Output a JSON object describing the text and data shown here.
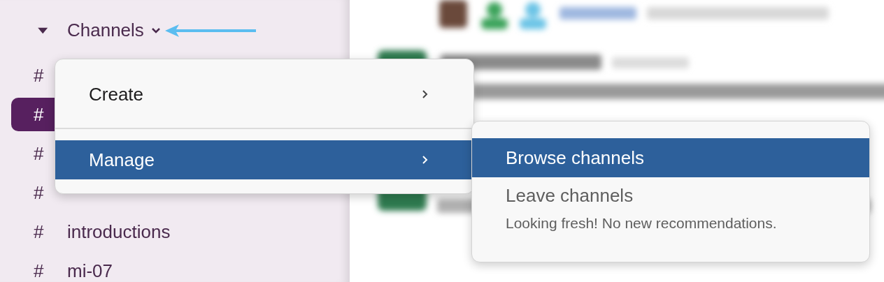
{
  "sidebar": {
    "section": {
      "title": "Channels",
      "expanded": true
    },
    "channels": [
      {
        "icon": "#",
        "selected": false
      },
      {
        "icon": "#",
        "selected": true
      },
      {
        "icon": "#",
        "selected": false
      },
      {
        "icon": "#",
        "selected": false
      },
      {
        "icon": "#",
        "name": "introductions",
        "selected": false
      },
      {
        "icon": "#",
        "name": "mi-07",
        "selected": false
      }
    ]
  },
  "menu": {
    "items": [
      {
        "label": "Create",
        "selected": false
      },
      {
        "label": "Manage",
        "selected": true
      }
    ]
  },
  "submenu": {
    "items": [
      {
        "label": "Browse channels",
        "selected": true
      },
      {
        "label": "Leave channels",
        "selected": false,
        "note": "Looking fresh! No new recommendations."
      }
    ]
  }
}
